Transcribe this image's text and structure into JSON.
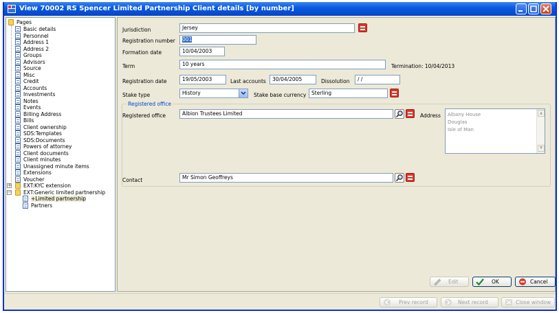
{
  "window": {
    "title": "View 70002 RS Spencer Limited Partnership Client details [by number]"
  },
  "tree": {
    "root": "Pages",
    "pages": [
      "Basic details",
      "Personnel",
      "Address 1",
      "Address 2",
      "Groups",
      "Advisors",
      "Source",
      "Misc",
      "Credit",
      "Accounts",
      "Investments",
      "Notes",
      "Events",
      "Billing Address",
      "Bills",
      "Client ownership",
      "SDS:Templates",
      "SDS:Documents",
      "Powers of attorney",
      "Client documents",
      "Client minutes",
      "Unassigned minute items",
      "Extensions",
      "Voucher"
    ],
    "folders": [
      {
        "label": "EXT:KYC extension",
        "expander": "+"
      },
      {
        "label": "EXT:Generic limited partnership",
        "expander": "−"
      }
    ],
    "sub_items": [
      "+Limited partnership",
      "Partners"
    ]
  },
  "form": {
    "jurisdiction_label": "Jurisdiction",
    "jurisdiction_value": "Jersey",
    "registration_number_label": "Registration number",
    "registration_number_value": "001",
    "formation_date_label": "Formation date",
    "formation_date_value": "10/04/2003",
    "term_label": "Term",
    "term_value": "10 years",
    "termination_label": "Termination: 10/04/2013",
    "registration_date_label": "Registration date",
    "registration_date_value": "19/05/2003",
    "last_accounts_label": "Last accounts",
    "last_accounts_value": "30/04/2005",
    "dissolution_label": "Dissolution",
    "dissolution_value": " / /",
    "stake_type_label": "Stake type",
    "stake_type_value": "History",
    "stake_base_currency_label": "Stake base currency",
    "stake_base_currency_value": "Sterling",
    "registered_office_group": "Registered office",
    "registered_office_label": "Registered office",
    "registered_office_value": "Albion Trustees Limited",
    "address_label": "Address",
    "address_lines": [
      "Albany House",
      "Douglas",
      "Isle of Man"
    ],
    "contact_label": "Contact",
    "contact_value": "Mr Simon Geoffreys"
  },
  "buttons": {
    "edit": "Edit",
    "ok": "OK",
    "cancel": "Cancel",
    "prev_record": "Prev record",
    "next_record": "Next record",
    "close_window": "Close window"
  },
  "colors": {
    "titlebar": "#0a5be0",
    "group_title": "#0046d5",
    "list_button": "#d8372b"
  }
}
